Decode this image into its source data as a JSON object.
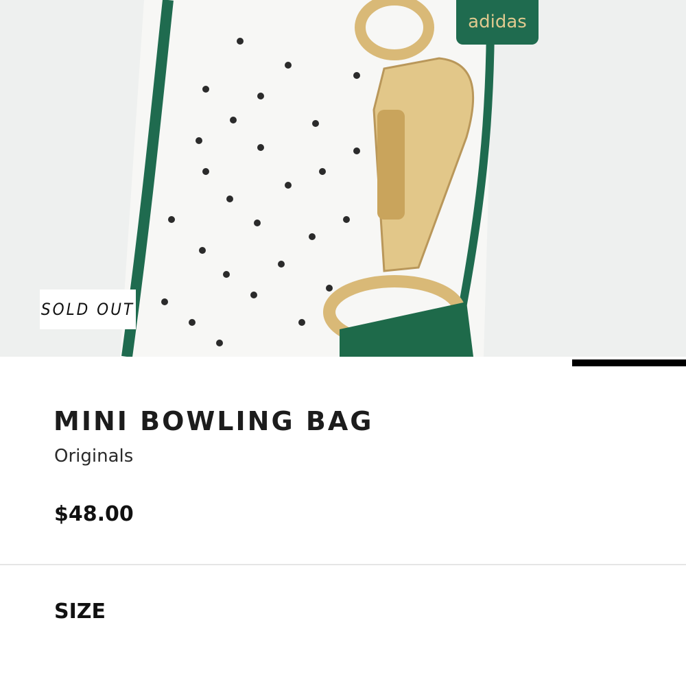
{
  "product": {
    "badge": "SOLD OUT",
    "title": "MINI BOWLING BAG",
    "subtitle": "Originals",
    "price": "$48.00",
    "image_tag_text": "adidas"
  },
  "sections": {
    "size_label": "SIZE"
  },
  "colors": {
    "accent_green": "#1f6b4f",
    "gold": "#d9b977",
    "text": "#111111"
  }
}
